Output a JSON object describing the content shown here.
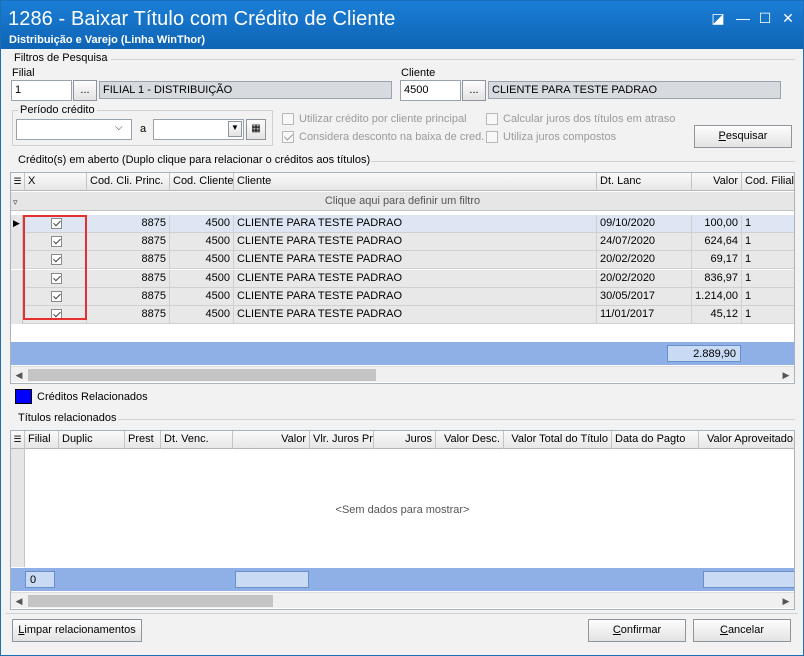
{
  "window": {
    "title": "1286 - Baixar Título com Crédito de Cliente",
    "subtitle": "Distribuição e Varejo (Linha WinThor)",
    "controls": [
      "◪",
      "—",
      "☐",
      "✕"
    ]
  },
  "filters": {
    "group_title": "Filtros de Pesquisa",
    "filial_label": "Filial",
    "filial_value": "1",
    "filial_name": "FILIAL 1 - DISTRIBUIÇÃO",
    "cliente_label": "Cliente",
    "cliente_value": "4500",
    "cliente_name": "CLIENTE PARA TESTE PADRAO",
    "browse_label": "...",
    "periodo_label": "Período crédito",
    "periodo_sep": "a",
    "chk_credito_principal": "Utilizar crédito por cliente principal",
    "chk_considera_desconto": "Considera desconto na baixa de cred.",
    "chk_calcular_juros": "Calcular juros dos títulos em atraso",
    "chk_juros_compostos": "Utiliza juros compostos",
    "pesquisar_label": "Pesquisar"
  },
  "creditos": {
    "group_title": "Crédito(s) em aberto  (Duplo clique para relacionar o créditos aos títulos)",
    "columns": [
      "X",
      "Cod. Cli. Princ.",
      "Cod. Cliente",
      "Cliente",
      "Dt. Lanc",
      "Valor",
      "Cod. Filial"
    ],
    "filter_hint": "Clique aqui para definir um filtro",
    "rows": [
      {
        "cod_princ": "8875",
        "cod_cliente": "4500",
        "cliente": "CLIENTE PARA TESTE PADRAO",
        "dt_lanc": "09/10/2020",
        "valor": "100,00",
        "filial": "1"
      },
      {
        "cod_princ": "8875",
        "cod_cliente": "4500",
        "cliente": "CLIENTE PARA TESTE PADRAO",
        "dt_lanc": "24/07/2020",
        "valor": "624,64",
        "filial": "1"
      },
      {
        "cod_princ": "8875",
        "cod_cliente": "4500",
        "cliente": "CLIENTE PARA TESTE PADRAO",
        "dt_lanc": "20/02/2020",
        "valor": "69,17",
        "filial": "1"
      },
      {
        "cod_princ": "8875",
        "cod_cliente": "4500",
        "cliente": "CLIENTE PARA TESTE PADRAO",
        "dt_lanc": "20/02/2020",
        "valor": "836,97",
        "filial": "1"
      },
      {
        "cod_princ": "8875",
        "cod_cliente": "4500",
        "cliente": "CLIENTE PARA TESTE PADRAO",
        "dt_lanc": "30/05/2017",
        "valor": "1.214,00",
        "filial": "1"
      },
      {
        "cod_princ": "8875",
        "cod_cliente": "4500",
        "cliente": "CLIENTE PARA TESTE PADRAO",
        "dt_lanc": "11/01/2017",
        "valor": "45,12",
        "filial": "1"
      }
    ],
    "total": "2.889,90",
    "legend_label": "Créditos Relacionados",
    "legend_color": "#0000ff"
  },
  "titulos": {
    "group_title": "Títulos relacionados",
    "columns": [
      "Filial",
      "Duplic",
      "Prest",
      "Dt. Venc.",
      "Valor",
      "Vlr. Juros Pr",
      "Juros",
      "Valor Desc.",
      "Valor Total do Título",
      "Data do Pagto",
      "Valor Aproveitado"
    ],
    "empty_text": "<Sem dados para mostrar>",
    "count": "0"
  },
  "footer": {
    "limpar_label": "Limpar relacionamentos",
    "confirmar_label": "Confirmar",
    "cancelar_label": "Cancelar"
  }
}
